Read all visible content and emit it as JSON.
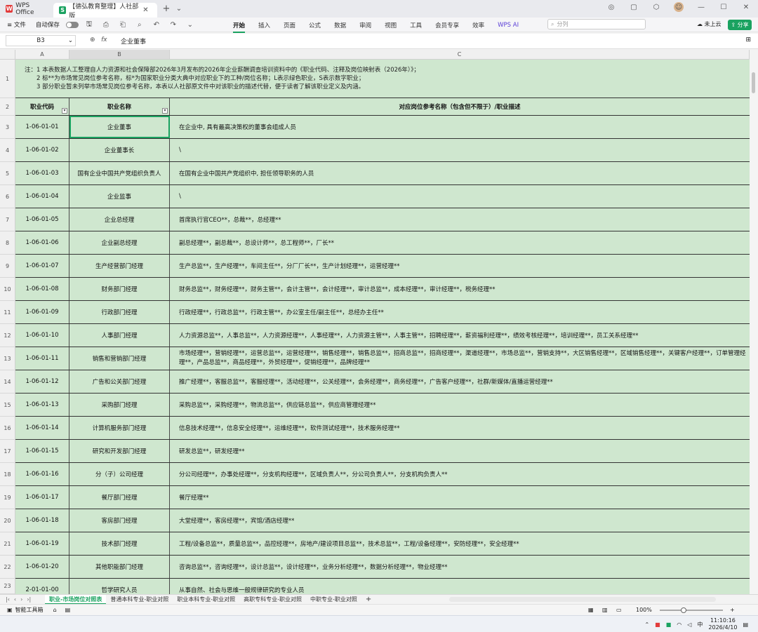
{
  "window": {
    "app_tab": "WPS Office",
    "doc_tab": "【德弘教育整理】人社部版",
    "new_tab": "+"
  },
  "toolbar": {
    "file": "≡ 文件",
    "autosave": "自动保存",
    "menus": [
      "开始",
      "插入",
      "页面",
      "公式",
      "数据",
      "审阅",
      "视图",
      "工具",
      "会员专享",
      "效率",
      "WPS AI"
    ],
    "search_placeholder": "分列",
    "cloud": "未上云",
    "share": "分享"
  },
  "formula": {
    "cell_ref": "B3",
    "fx": "fx",
    "content": "企业董事"
  },
  "columns": [
    "A",
    "B",
    "C"
  ],
  "note": {
    "line1": "注：1 本表数据人工整理自人力资源和社会保障部2026年3月发布的2026年企业薪酬调查培训资料中的《职业代码、注释及岗位映射表（2026年）》；",
    "line2": "　　2 标**为市场常见岗位参考名称，标*为国家职业分类大典中对应职业下的工种/岗位名称；L表示绿色职业，S表示数字职业；",
    "line3": "　　3 部分职业暂未列举市场常见岗位参考名称，本表以人社部原文件中对该职业的描述代替，便于读者了解该职业定义及内涵。"
  },
  "header": {
    "code": "职业代码",
    "name": "职业名称",
    "desc": "对应岗位参考名称（包含但不限于）/职业描述"
  },
  "rows": [
    {
      "n": "3",
      "code": "1-06-01-01",
      "name": "企业董事",
      "desc": "在企业中, 具有最高决策权的董事会组成人员"
    },
    {
      "n": "4",
      "code": "1-06-01-02",
      "name": "企业董事长",
      "desc": "\\"
    },
    {
      "n": "5",
      "code": "1-06-01-03",
      "name": "国有企业中国共产党组织负责人",
      "desc": "在国有企业中国共产党组织中, 担任领导职务的人员"
    },
    {
      "n": "6",
      "code": "1-06-01-04",
      "name": "企业监事",
      "desc": "\\"
    },
    {
      "n": "7",
      "code": "1-06-01-05",
      "name": "企业总经理",
      "desc": "首席执行官CEO**，总裁**，总经理**"
    },
    {
      "n": "8",
      "code": "1-06-01-06",
      "name": "企业副总经理",
      "desc": "副总经理**，副总裁**，总设计师**，总工程师**，厂长**"
    },
    {
      "n": "9",
      "code": "1-06-01-07",
      "name": "生产经营部门经理",
      "desc": "生产总监**，生产经理**，车间主任**，分厂厂长**，生产计划经理**，运营经理**"
    },
    {
      "n": "10",
      "code": "1-06-01-08",
      "name": "财务部门经理",
      "desc": "财务总监**，财务经理**，财务主管**，会计主管**，会计经理**，审计总监**，成本经理**，审计经理**，税务经理**"
    },
    {
      "n": "11",
      "code": "1-06-01-09",
      "name": "行政部门经理",
      "desc": "行政经理**，行政总监**，行政主管**，办公室主任/副主任**，总经办主任**"
    },
    {
      "n": "12",
      "code": "1-06-01-10",
      "name": "人事部门经理",
      "desc": "人力资源总监**，人事总监**，人力资源经理**，人事经理**，人力资源主管**，人事主管**，招聘经理**，薪资福利经理**，绩效考核经理**，培训经理**，员工关系经理**"
    },
    {
      "n": "13",
      "code": "1-06-01-11",
      "name": "销售和营销部门经理",
      "desc": "市场经理**，营销经理**，运营总监**，运营经理**，销售经理**，销售总监**，招商总监**，招商经理**，渠道经理**，市场总监**，营销支持**，大区销售经理**，区域销售经理**，关键客户经理**，订单管理经理**，产品总监**，商品经理**，外贸经理**，促销经理**，品牌经理**"
    },
    {
      "n": "14",
      "code": "1-06-01-12",
      "name": "广告和公关部门经理",
      "desc": "推广经理**，客服总监**，客服经理**，活动经理**，公关经理**，会务经理**，商务经理**，广告客户经理**，社群/新媒体/直播运营经理**"
    },
    {
      "n": "15",
      "code": "1-06-01-13",
      "name": "采购部门经理",
      "desc": "采购总监**，采购经理**，物流总监**，供应链总监**，供应商管理经理**"
    },
    {
      "n": "16",
      "code": "1-06-01-14",
      "name": "计算机服务部门经理",
      "desc": "信息技术经理**，信息安全经理**，运维经理**，软件测试经理**，技术服务经理**"
    },
    {
      "n": "17",
      "code": "1-06-01-15",
      "name": "研究和开发部门经理",
      "desc": "研发总监**，研发经理**"
    },
    {
      "n": "18",
      "code": "1-06-01-16",
      "name": "分（子）公司经理",
      "desc": "分公司经理**，办事处经理**，分支机构经理**，区域负责人**，分公司负责人**，分支机构负责人**"
    },
    {
      "n": "19",
      "code": "1-06-01-17",
      "name": "餐厅部门经理",
      "desc": "餐厅经理**"
    },
    {
      "n": "20",
      "code": "1-06-01-18",
      "name": "客房部门经理",
      "desc": "大堂经理**，客房经理**，宾馆/酒店经理**"
    },
    {
      "n": "21",
      "code": "1-06-01-19",
      "name": "技术部门经理",
      "desc": "工程/设备总监**，质量总监**，品控经理**，房地产/建设项目总监**，技术总监**，工程/设备经理**，安防经理**，安全经理**"
    },
    {
      "n": "22",
      "code": "1-06-01-20",
      "name": "其他职能部门经理",
      "desc": "咨询总监**，咨询经理**，设计总监**，设计经理**，业务分析经理**，数据分析经理**，物业经理**"
    },
    {
      "n": "23",
      "code": "2-01-01-00",
      "name": "哲学研究人员",
      "desc": "从事自然、社会与思维一般规律研究的专业人员"
    }
  ],
  "sheets": [
    "职业-市场岗位对照表",
    "普通本科专业-职业对照",
    "职业本科专业-职业对照",
    "高职专科专业-职业对照",
    "中职专业-职业对照"
  ],
  "status": {
    "left": "智能工具箱",
    "zoom": "100%"
  },
  "taskbar": {
    "ime": "中",
    "time": "11:10:16",
    "date": "2026/4/10"
  }
}
